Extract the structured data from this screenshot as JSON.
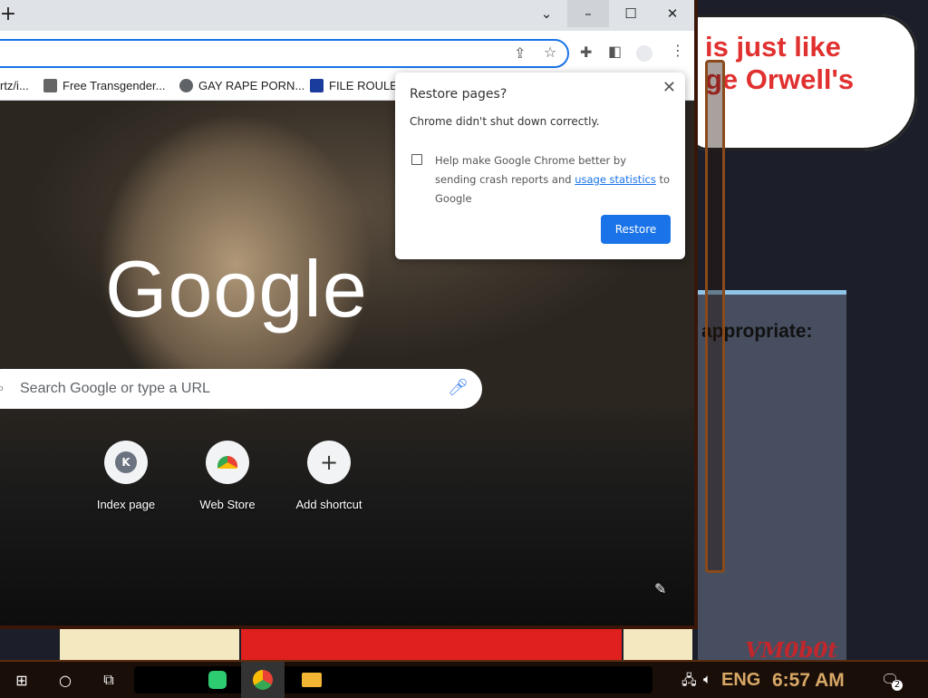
{
  "desktop": {
    "bubble_text": "is just like\nge Orwell's",
    "panel_text": "appropriate:",
    "logo_text": "VM0b0t"
  },
  "window": {
    "controls": {
      "dropdown": "⌄",
      "minimize": "–",
      "maximize": "☐",
      "close": "✕"
    },
    "bookmarks": [
      {
        "label": "rtz/i...",
        "icon_color": "#ffffff"
      },
      {
        "label": "Free Transgender...",
        "icon_color": "#666666"
      },
      {
        "label": "GAY RAPE PORN...",
        "icon_color": "#5f6368"
      },
      {
        "label": "FILE ROULE",
        "icon_color": "#1a3c9c"
      }
    ]
  },
  "ntp": {
    "logo": "Google",
    "search_placeholder": "Search Google or type a URL",
    "shortcuts": [
      {
        "label": "Index page",
        "letter": "K"
      },
      {
        "label": "Web Store",
        "letter": ""
      },
      {
        "label": "Add shortcut",
        "letter": "+"
      }
    ]
  },
  "dialog": {
    "title": "Restore pages?",
    "message": "Chrome didn't shut down correctly.",
    "checkbox_text_before": "Help make Google Chrome better by sending crash reports and ",
    "link_text": "usage statistics",
    "checkbox_text_after": " to Google",
    "button": "Restore",
    "accent": "#1a73e8"
  },
  "taskbar": {
    "language": "ENG",
    "time": "6:57 AM",
    "notification_count": "2"
  }
}
